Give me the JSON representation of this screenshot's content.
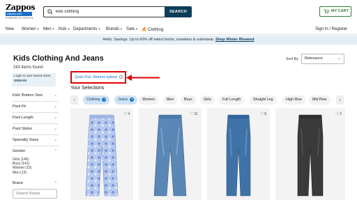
{
  "header": {
    "logo_word": "Zappos",
    "logo_bar": "zappos.com",
    "logo_tag": "POWERED BY SERVICE",
    "search_value": "kids clothing",
    "search_button": "SEARCH",
    "cart_label": "MY CART"
  },
  "nav": {
    "items": [
      "New",
      "Women",
      "Men",
      "Kids",
      "Departments",
      "Brands",
      "Sale",
      "Clothing"
    ],
    "signin": "Sign In / Register"
  },
  "promo": {
    "text": "Hello, Savings. Up to 60% off select boots, sneakers & outerwear.",
    "link": "Shop Winter Blowout"
  },
  "page": {
    "title": "Kids Clothing And Jeans",
    "count": "243 items found",
    "sort_label": "Sort By",
    "sort_value": "Relevance"
  },
  "sidebar": {
    "login_text": "Login to see saved sizes",
    "login_link": "SIGN IN",
    "filters": [
      "Kids' Bottom Size",
      "Pant Fit",
      "Pant Length",
      "Pant Styles",
      "Specialty Sizes",
      "Gender"
    ],
    "gender_options": [
      "Girls (146)",
      "Boys (141)",
      "Women (15)",
      "Men (13)"
    ],
    "brand_label": "Brand",
    "brand_search_placeholder": "Search Brand"
  },
  "quick_pick": {
    "label": "Quick Pick: Returns options"
  },
  "selections": {
    "title": "Your Selections",
    "chips": [
      "Clothing",
      "Jeans",
      "Women",
      "Men",
      "Boys",
      "Girls",
      "Full Length",
      "Straight Leg",
      "High Rise",
      "Mid Rise"
    ]
  },
  "products": [
    {
      "fav_count": "4",
      "color": "#a7bde6",
      "style": "floral-flare"
    },
    {
      "fav_count": "21",
      "color": "#5b87b6",
      "style": "medium-flare"
    },
    {
      "fav_count": "8",
      "color": "#3f73a8",
      "style": "medium-straight"
    },
    {
      "fav_count": "2",
      "color": "#3a3a3a",
      "style": "black-straight"
    }
  ],
  "colors": {
    "brand_blue": "#1a6fc5",
    "search_button": "#093d59",
    "cart_green": "#2e7d32",
    "annotation_red": "#e00000",
    "promo_bg": "#e6eef5"
  }
}
